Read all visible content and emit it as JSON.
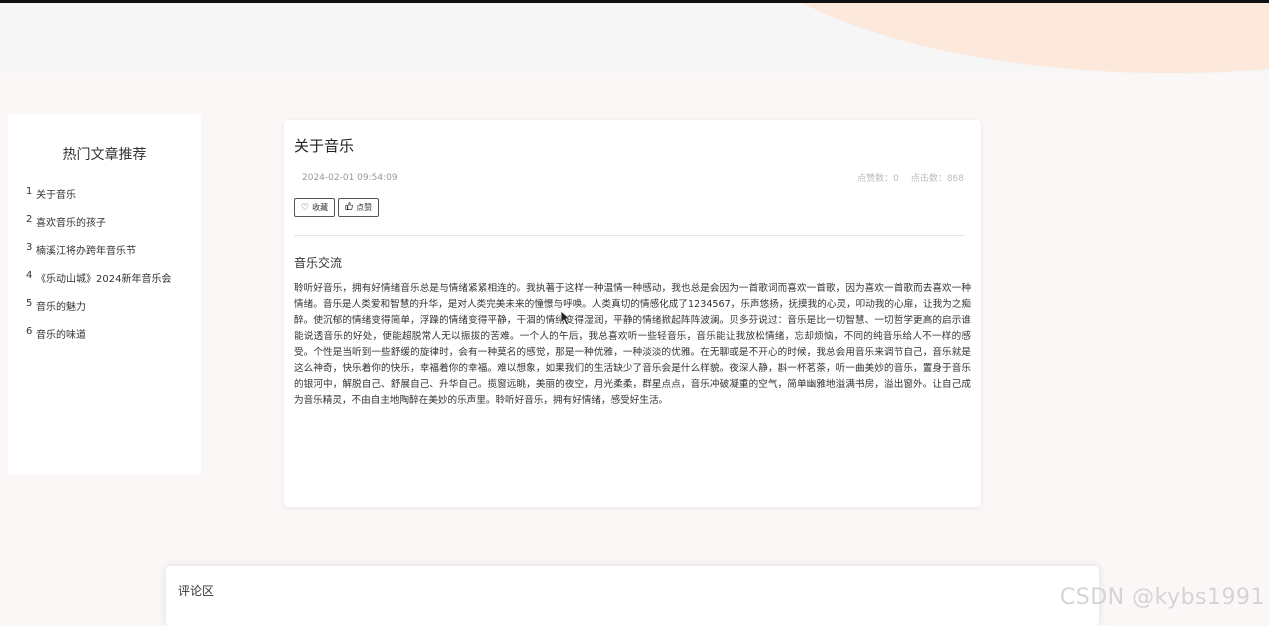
{
  "sidebar": {
    "title": "热门文章推荐",
    "items": [
      {
        "num": "1",
        "label": "关于音乐"
      },
      {
        "num": "2",
        "label": "喜欢音乐的孩子"
      },
      {
        "num": "3",
        "label": "楠溪江将办跨年音乐节"
      },
      {
        "num": "4",
        "label": "《乐动山城》2024新年音乐会"
      },
      {
        "num": "5",
        "label": "音乐的魅力"
      },
      {
        "num": "6",
        "label": "音乐的味道"
      }
    ]
  },
  "article": {
    "title": "关于音乐",
    "date": "2024-02-01 09:54:09",
    "likes_label": "点赞数：0",
    "clicks_label": "点击数：868",
    "favorite_button": "收藏",
    "like_button": "点赞",
    "section_title": "音乐交流",
    "body": "聆听好音乐，拥有好情绪音乐总是与情绪紧紧相连的。我执著于这样一种温情一种感动，我也总是会因为一首歌词而喜欢一首歌，因为喜欢一首歌而去喜欢一种情绪。音乐是人类爱和智慧的升华，是对人类完美未来的憧憬与呼唤。人类真切的情感化成了1234567，乐声悠扬，抚摸我的心灵，叩动我的心扉，让我为之痴醉。使沉郁的情绪变得简单，浮躁的情绪变得平静，干涸的情绪变得湿润，平静的情绪掀起阵阵波澜。贝多芬说过：音乐是比一切智慧、一切哲学更高的启示谁能说透音乐的好处，便能超脱常人无以振拔的苦难。一个人的午后，我总喜欢听一些轻音乐，音乐能让我放松情绪，忘却烦恼，不同的纯音乐给人不一样的感受。个性是当听到一些舒缓的旋律时，会有一种莫名的感觉，那是一种优雅，一种淡淡的优雅。在无聊或是不开心的时候，我总会用音乐来调节自己，音乐就是这么神奇，快乐着你的快乐，幸福着你的幸福。难以想象，如果我们的生活缺少了音乐会是什么样貌。夜深人静，斟一杯茗茶，听一曲美妙的音乐，置身于音乐的银河中，解脱自己、舒展自己、升华自己。揽窗远眺，美丽的夜空，月光柔柔，群星点点，音乐冲破凝重的空气，简单幽雅地溢满书房，溢出窗外。让自己成为音乐精灵，不由自主地陶醉在美妙的乐声里。聆听好音乐，拥有好情绪，感受好生活。"
  },
  "comments": {
    "title": "评论区"
  },
  "watermark": "CSDN @kybs1991",
  "colors": {
    "header_blob": "#fde8dc",
    "background": "#faf7f6"
  },
  "icons": {
    "favorite": "heart-icon",
    "like": "thumbs-up-icon"
  }
}
